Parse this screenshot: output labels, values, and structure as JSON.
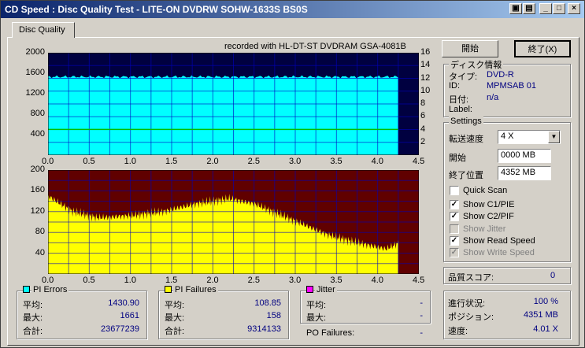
{
  "window": {
    "title": "CD Speed : Disc Quality Test - LITE-ON DVDRW SOHW-1633S BS0S",
    "tab": "Disc Quality"
  },
  "chart_header": "recorded with HL-DT-ST DVDRAM GSA-4081B",
  "colors": {
    "cyan": "#00ffff",
    "navy": "#000040",
    "maroon": "#600000",
    "yellow": "#ffff00",
    "grid": "#0000c0",
    "green": "#00c000"
  },
  "chart_data": [
    {
      "type": "area",
      "name": "PI Errors",
      "x_ticks": [
        "0.0",
        "0.5",
        "1.0",
        "1.5",
        "2.0",
        "2.5",
        "3.0",
        "3.5",
        "4.0",
        "4.5"
      ],
      "y_ticks_left": [
        "2000",
        "1600",
        "1200",
        "800",
        "400"
      ],
      "y_ticks_right": [
        "16",
        "14",
        "12",
        "10",
        "8",
        "6",
        "4",
        "2"
      ],
      "xlim": [
        0,
        4.5
      ],
      "ylim": [
        0,
        2000
      ],
      "y2lim": [
        0,
        16
      ],
      "data_end_x": 4.25,
      "pi_level": 1430,
      "pi_max": 1661,
      "read_speed_x": 4.01
    },
    {
      "type": "area",
      "name": "PI Failures",
      "x_ticks": [
        "0.0",
        "0.5",
        "1.0",
        "1.5",
        "2.0",
        "2.5",
        "3.0",
        "3.5",
        "4.0",
        "4.5"
      ],
      "y_ticks_left": [
        "200",
        "160",
        "120",
        "80",
        "40"
      ],
      "xlim": [
        0,
        4.5
      ],
      "ylim": [
        0,
        200
      ],
      "data_end_x": 4.25,
      "profile_x": [
        0.0,
        0.1,
        0.3,
        0.6,
        1.0,
        1.4,
        1.8,
        2.2,
        2.5,
        2.8,
        3.1,
        3.4,
        3.7,
        3.9,
        4.1,
        4.2,
        4.25
      ],
      "profile_y": [
        150,
        140,
        120,
        108,
        112,
        120,
        135,
        145,
        135,
        115,
        95,
        75,
        62,
        55,
        48,
        55,
        60
      ]
    }
  ],
  "buttons": {
    "start": "開始",
    "exit": "終了(X)"
  },
  "disc_info": {
    "title": "ディスク情報",
    "type_label": "タイプ:",
    "type_value": "DVD-R",
    "id_label": "ID:",
    "id_value": "MPMSAB 01",
    "date_label": "日付:",
    "date_value": "n/a",
    "label_label": "Label:"
  },
  "settings": {
    "title": "Settings",
    "speed_label": "転送速度",
    "speed_value": "4 X",
    "start_label": "開始",
    "start_value": "0000 MB",
    "end_label": "終了位置",
    "end_value": "4352 MB",
    "quick_scan": "Quick Scan",
    "show_c1": "Show C1/PIE",
    "show_c2": "Show C2/PIF",
    "show_jitter": "Show Jitter",
    "show_read": "Show Read Speed",
    "show_write": "Show Write Speed"
  },
  "quality": {
    "label": "品質スコア:",
    "value": "0"
  },
  "progress": {
    "progress_label": "進行状況:",
    "progress_value": "100 %",
    "position_label": "ポジション:",
    "position_value": "4351 MB",
    "speed_label": "速度:",
    "speed_value": "4.01 X"
  },
  "pi_errors": {
    "title": "PI Errors",
    "avg_label": "平均:",
    "avg_value": "1430.90",
    "max_label": "最大:",
    "max_value": "1661",
    "total_label": "合計:",
    "total_value": "23677239"
  },
  "pi_failures": {
    "title": "PI Failures",
    "avg_label": "平均:",
    "avg_value": "108.85",
    "max_label": "最大:",
    "max_value": "158",
    "total_label": "合計:",
    "total_value": "9314133"
  },
  "jitter": {
    "title": "Jitter",
    "avg_label": "平均:",
    "avg_value": "-",
    "max_label": "最大:",
    "max_value": "-"
  },
  "po_failures": {
    "label": "PO Failures:",
    "value": "-"
  }
}
